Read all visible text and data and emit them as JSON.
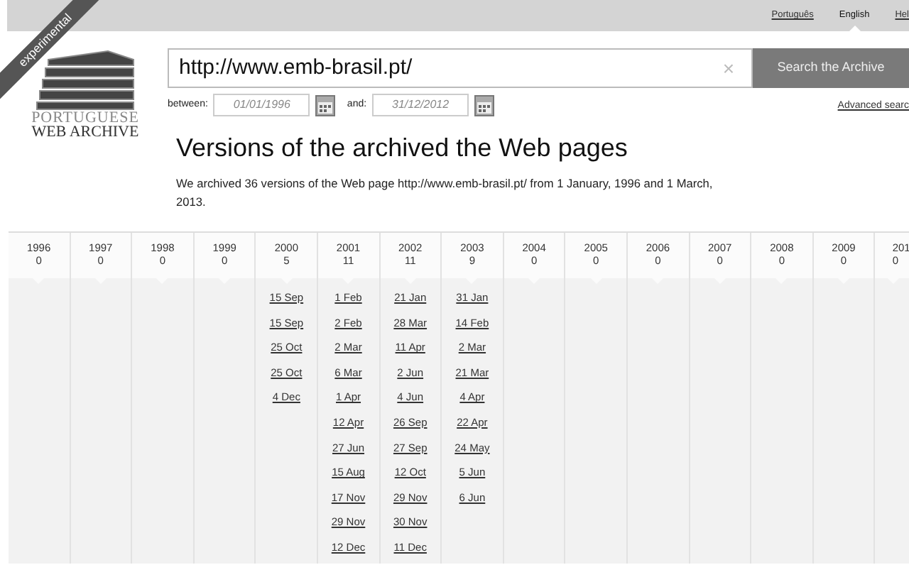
{
  "ribbon": "experimental",
  "logo": {
    "line1": "PORTUGUESE",
    "line2": "WEB ARCHIVE"
  },
  "languages": [
    {
      "label": "Português",
      "selected": false
    },
    {
      "label": "English",
      "selected": true
    },
    {
      "label": "Hel",
      "selected": false
    }
  ],
  "search": {
    "value": "http://www.emb-brasil.pt/",
    "clear": "×",
    "button": "Search the Archive",
    "advanced": "Advanced searc"
  },
  "dates": {
    "between_label": "between:",
    "from": "01/01/1996",
    "and_label": "and:",
    "to": "31/12/2012"
  },
  "title": "Versions of the archived the Web pages",
  "summary": "We archived 36 versions of the Web page http://www.emb-brasil.pt/ from 1 January, 1996 and 1 March, 2013.",
  "years": [
    {
      "year": "1996",
      "count": "0"
    },
    {
      "year": "1997",
      "count": "0"
    },
    {
      "year": "1998",
      "count": "0"
    },
    {
      "year": "1999",
      "count": "0"
    },
    {
      "year": "2000",
      "count": "5",
      "versions": [
        "15 Sep",
        "15 Sep",
        "25 Oct",
        "25 Oct",
        "4 Dec"
      ]
    },
    {
      "year": "2001",
      "count": "11",
      "versions": [
        "1 Feb",
        "2 Feb",
        "2 Mar",
        "6 Mar",
        "1 Apr",
        "12 Apr",
        "27 Jun",
        "15 Aug",
        "17 Nov",
        "29 Nov",
        "12 Dec"
      ]
    },
    {
      "year": "2002",
      "count": "11",
      "versions": [
        "21 Jan",
        "28 Mar",
        "11 Apr",
        "2 Jun",
        "4 Jun",
        "26 Sep",
        "27 Sep",
        "12 Oct",
        "29 Nov",
        "30 Nov",
        "11 Dec"
      ]
    },
    {
      "year": "2003",
      "count": "9",
      "versions": [
        "31 Jan",
        "14 Feb",
        "2 Mar",
        "21 Mar",
        "4 Apr",
        "22 Apr",
        "24 May",
        "5 Jun",
        "6 Jun"
      ]
    },
    {
      "year": "2004",
      "count": "0"
    },
    {
      "year": "2005",
      "count": "0"
    },
    {
      "year": "2006",
      "count": "0"
    },
    {
      "year": "2007",
      "count": "0"
    },
    {
      "year": "2008",
      "count": "0"
    },
    {
      "year": "2009",
      "count": "0"
    },
    {
      "year": "201",
      "count": "0"
    }
  ]
}
